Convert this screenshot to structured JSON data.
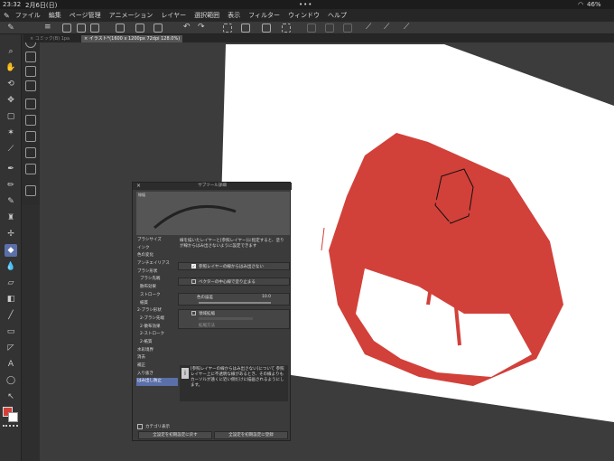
{
  "status": {
    "time": "23:32",
    "date": "2月6日(日)",
    "battery": "46%"
  },
  "menu": [
    "ファイル",
    "編集",
    "ページ管理",
    "アニメーション",
    "レイヤー",
    "選択範囲",
    "表示",
    "フィルター",
    "ウィンドウ",
    "ヘルプ"
  ],
  "tabs": [
    "コミック(B) 1pa",
    "イラスト*(1600 x 1200px 72dpi 128.0%)"
  ],
  "dialog": {
    "title": "サブツール詳細",
    "preview_label": "線幅",
    "categories": [
      "ブラシサイズ",
      "インク",
      "色の変化",
      "アンチエイリアス",
      "ブラシ形状",
      "ブラシ先端",
      "散布効果",
      "ストローク",
      "紙質",
      "2-ブラシ形状",
      "2-ブラシ先端",
      "2-散布効果",
      "2-ストローク",
      "2-紙質",
      "水彩境界",
      "消去",
      "補正",
      "入り抜き",
      "はみ出し防止"
    ],
    "selected_index": 18,
    "desc_text": "線を描いたレイヤーと[参照レイヤー]に指定すると、塗りが線からはみ出さないように設定できます",
    "opt1": "参照レイヤーの線からはみ出さない",
    "opt2": "ベクターの中心線で塗り止まる",
    "opt3": "色の誤差",
    "opt3_value": "10.0",
    "opt4": "領域拡縮",
    "opt5": "拡縮方法",
    "info_text": "[参照レイヤーの線からはみ出さない]について 参照レイヤー上に不透明な線があるとき、その線よりもカーソルが遠くに近い側だけに描画されるようにします。",
    "show_category": "カテゴリ表示",
    "btn_reset": "全設定を初期設定に戻す",
    "btn_register": "全設定を初期設定に登録"
  },
  "colors": {
    "canvas_bg": "#3c3c3c",
    "paper": "#ffffff",
    "paint_red": "#d2403a",
    "highlight": "#5b6fa8"
  }
}
